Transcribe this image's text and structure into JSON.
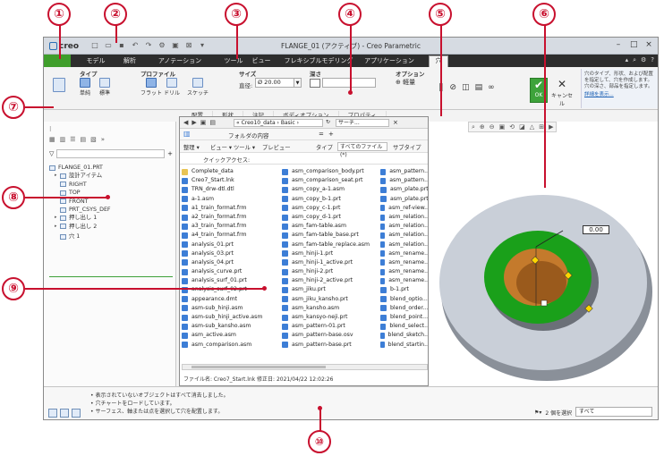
{
  "window": {
    "app_name": "creo",
    "title": "FLANGE_01 (アクティブ) - Creo Parametric"
  },
  "ribbon_tabs": [
    {
      "label": "モデル"
    },
    {
      "label": "解析"
    },
    {
      "label": "アノテーション"
    },
    {
      "label": "ツール"
    },
    {
      "label": "ビュー"
    },
    {
      "label": "フレキシブルモデリング"
    },
    {
      "label": "アプリケーション"
    },
    {
      "label": "穴"
    }
  ],
  "ribbon": {
    "type_group": "タイプ",
    "type_simple": "単純",
    "type_standard": "標準",
    "profile_group": "プロファイル",
    "profile_flat": "フラット",
    "profile_drill": "ドリル",
    "profile_sketch": "スケッチ",
    "size_group": "サイズ",
    "diameter_label": "直径:",
    "diameter_value": "Ø 20.00",
    "depth_group": "深さ",
    "options_group": "オプション",
    "options_lightweight": "軽量",
    "ok_label": "OK",
    "cancel_label": "キャンセル",
    "help_text": "穴のタイプ、形状、および配置を指定して、穴を作成します。穴の深さ、部品を指定します。",
    "help_link": "詳細を表示..."
  },
  "subtabs": [
    "配置",
    "形状",
    "注記",
    "ボディオプション",
    "プロパティ"
  ],
  "model_tree": [
    {
      "label": "FLANGE_01.PRT",
      "level": 0
    },
    {
      "label": "設計アイテム",
      "level": 1
    },
    {
      "label": "RIGHT",
      "level": 1
    },
    {
      "label": "TOP",
      "level": 1
    },
    {
      "label": "FRONT",
      "level": 1
    },
    {
      "label": "PRT_CSYS_DEF",
      "level": 1
    },
    {
      "label": "押し出し 1",
      "level": 1
    },
    {
      "label": "押し出し 2",
      "level": 1
    },
    {
      "label": "穴 1",
      "level": 1
    }
  ],
  "dialog": {
    "path": "« Creo10_data › Basic ›",
    "search_placeholder": "サーチ...",
    "folder_label": "フォルダの内容",
    "organize": "整理 ▾",
    "views": "ビュー ▾",
    "tools": "ツール ▾",
    "preview": "プレビュー",
    "type_label": "タイプ",
    "type_value": "すべてのファイル (*)",
    "subtype_label": "サブタイプ",
    "quick_access": "クイックアクセス:",
    "status": "ファイル名: Creo7_Start.lnk  修正日: 2021/04/22 12:02:26",
    "files_col1": [
      {
        "name": "Complete_data",
        "kind": "folder"
      },
      {
        "name": "Creo7_Start.lnk",
        "kind": "file"
      },
      {
        "name": "TRN_drw-dtl.dtl",
        "kind": "file"
      },
      {
        "name": "a-1.asm",
        "kind": "file"
      },
      {
        "name": "a1_train_format.frm",
        "kind": "file"
      },
      {
        "name": "a2_train_format.frm",
        "kind": "file"
      },
      {
        "name": "a3_train_format.frm",
        "kind": "file"
      },
      {
        "name": "a4_train_format.frm",
        "kind": "file"
      },
      {
        "name": "analysis_01.prt",
        "kind": "file"
      },
      {
        "name": "analysis_03.prt",
        "kind": "file"
      },
      {
        "name": "analysis_04.prt",
        "kind": "file"
      },
      {
        "name": "analysis_curve.prt",
        "kind": "file"
      },
      {
        "name": "analysis_surf_01.prt",
        "kind": "file"
      },
      {
        "name": "analysis_surf_02.prt",
        "kind": "file"
      },
      {
        "name": "appearance.dmt",
        "kind": "file"
      },
      {
        "name": "asm-sub_hinji.asm",
        "kind": "file"
      },
      {
        "name": "asm-sub_hinji_active.asm",
        "kind": "file"
      },
      {
        "name": "asm-sub_kansho.asm",
        "kind": "file"
      },
      {
        "name": "asm_active.asm",
        "kind": "file"
      },
      {
        "name": "asm_comparison.asm",
        "kind": "file"
      }
    ],
    "files_col2": [
      {
        "name": "asm_comparison_body.prt",
        "kind": "file"
      },
      {
        "name": "asm_comparison_seat.prt",
        "kind": "file"
      },
      {
        "name": "asm_copy_a-1.asm",
        "kind": "file"
      },
      {
        "name": "asm_copy_b-1.prt",
        "kind": "file"
      },
      {
        "name": "asm_copy_c-1.prt",
        "kind": "file"
      },
      {
        "name": "asm_copy_d-1.prt",
        "kind": "file"
      },
      {
        "name": "asm_fam-table.asm",
        "kind": "file"
      },
      {
        "name": "asm_fam-table_base.prt",
        "kind": "file"
      },
      {
        "name": "asm_fam-table_replace.asm",
        "kind": "file"
      },
      {
        "name": "asm_hinji-1.prt",
        "kind": "file"
      },
      {
        "name": "asm_hinji-1_active.prt",
        "kind": "file"
      },
      {
        "name": "asm_hinji-2.prt",
        "kind": "file"
      },
      {
        "name": "asm_hinji-2_active.prt",
        "kind": "file"
      },
      {
        "name": "asm_jiku.prt",
        "kind": "file"
      },
      {
        "name": "asm_jiku_kansho.prt",
        "kind": "file"
      },
      {
        "name": "asm_kansho.asm",
        "kind": "file"
      },
      {
        "name": "asm_kansyo-neji.prt",
        "kind": "file"
      },
      {
        "name": "asm_pattern-01.prt",
        "kind": "file"
      },
      {
        "name": "asm_pattern-base.osv",
        "kind": "file"
      },
      {
        "name": "asm_pattern-base.prt",
        "kind": "file"
      }
    ],
    "files_col3": [
      {
        "name": "asm_pattern...",
        "kind": "file"
      },
      {
        "name": "asm_pattern...",
        "kind": "file"
      },
      {
        "name": "asm_plate.prt",
        "kind": "file"
      },
      {
        "name": "asm_plate.prt",
        "kind": "file"
      },
      {
        "name": "asm_ref-view...",
        "kind": "file"
      },
      {
        "name": "asm_relation...",
        "kind": "file"
      },
      {
        "name": "asm_relation...",
        "kind": "file"
      },
      {
        "name": "asm_relation...",
        "kind": "file"
      },
      {
        "name": "asm_relation...",
        "kind": "file"
      },
      {
        "name": "asm_rename...",
        "kind": "file"
      },
      {
        "name": "asm_rename...",
        "kind": "file"
      },
      {
        "name": "asm_rename...",
        "kind": "file"
      },
      {
        "name": "asm_rename...",
        "kind": "file"
      },
      {
        "name": "b-1.prt",
        "kind": "file"
      },
      {
        "name": "blend_optio...",
        "kind": "file"
      },
      {
        "name": "blend_order...",
        "kind": "file"
      },
      {
        "name": "blend_point...",
        "kind": "file"
      },
      {
        "name": "blend_select...",
        "kind": "file"
      },
      {
        "name": "blend_sketch...",
        "kind": "file"
      },
      {
        "name": "blend_startin...",
        "kind": "file"
      }
    ]
  },
  "graphics": {
    "dimension_value": "0.00"
  },
  "messages": [
    "表示されていないオブジェクトはすべて消去しました。",
    "穴チャートをロードしています。",
    "サーフェス、軸または点を選択して穴を配置します。"
  ],
  "status_bar": {
    "selection_text": "2 個を選択",
    "filter_value": "すべて"
  },
  "callouts": [
    "①",
    "②",
    "③",
    "④",
    "⑤",
    "⑥",
    "⑦",
    "⑧",
    "⑨",
    "⑩"
  ],
  "colors": {
    "callout": "#c8102e",
    "file_tab": "#3f9e2b",
    "ok_button": "#3ea33b",
    "flange_body": "#c9cfd8",
    "boss_green": "#1aa01a",
    "hole_orange": "#c47a2c"
  }
}
